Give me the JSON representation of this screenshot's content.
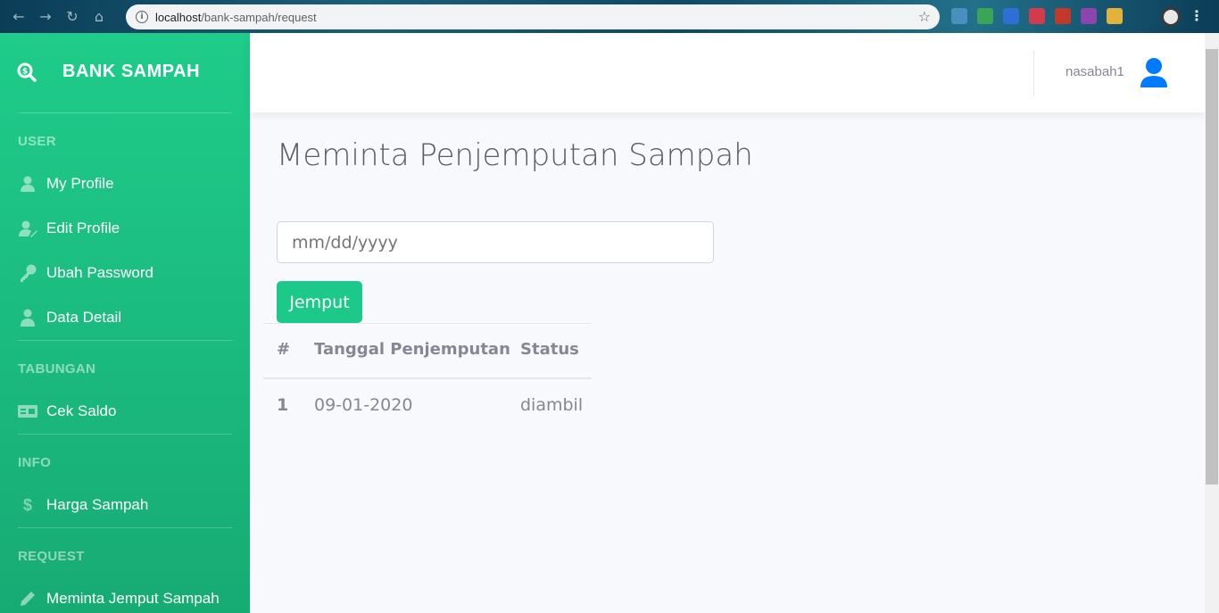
{
  "browser": {
    "url_host": "localhost",
    "url_path": "/bank-sampah/request",
    "ext_colors": [
      "#4b8fbf",
      "#3aa655",
      "#2e6fd6",
      "#d33a4a",
      "#c0392b",
      "#8e44ad",
      "#e2b33a"
    ]
  },
  "sidebar": {
    "brand": "BANK SAMPAH",
    "sections": {
      "user": "USER",
      "tabungan": "TABUNGAN",
      "info": "INFO",
      "request": "REQUEST"
    },
    "items": {
      "my_profile": "My Profile",
      "edit_profile": "Edit Profile",
      "ubah_password": "Ubah Password",
      "data_detail": "Data Detail",
      "cek_saldo": "Cek Saldo",
      "harga_sampah": "Harga Sampah",
      "meminta_jemput": "Meminta Jemput Sampah"
    },
    "icons": {
      "brand": "search-dollar-icon",
      "my_profile": "user-icon",
      "edit_profile": "user-edit-icon",
      "ubah_password": "key-icon",
      "data_detail": "user-tie-icon",
      "cek_saldo": "id-card-icon",
      "harga_sampah": "dollar-icon",
      "meminta_jemput": "pencil-icon"
    }
  },
  "topbar": {
    "username": "nasabah1"
  },
  "main": {
    "title": "Meminta Penjemputan Sampah",
    "date_placeholder": "mm/dd/yyyy",
    "submit_label": "Jemput",
    "table": {
      "headers": [
        "#",
        "Tanggal Penjemputan",
        "Status"
      ],
      "rows": [
        [
          "1",
          "09-01-2020",
          "diambil"
        ]
      ]
    }
  },
  "colors": {
    "accent": "#1cc88a",
    "avatar": "#007bff",
    "text_muted": "#858796"
  }
}
